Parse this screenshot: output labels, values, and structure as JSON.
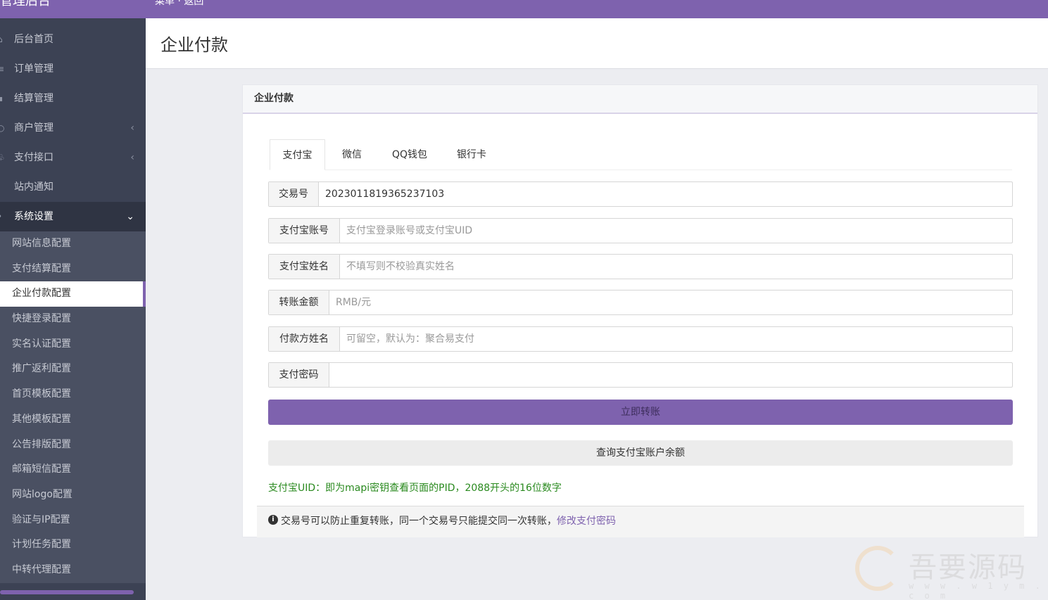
{
  "topbar": {
    "brand": "管理后台",
    "crumbs": "菜单 · 返回"
  },
  "sidebar": {
    "items": [
      {
        "label": "后台首页",
        "icon": "home-icon"
      },
      {
        "label": "订单管理",
        "icon": "list-icon"
      },
      {
        "label": "结算管理",
        "icon": "settle-icon"
      },
      {
        "label": "商户管理",
        "icon": "user-icon",
        "chevron": "‹"
      },
      {
        "label": "支付接口",
        "icon": "plug-icon",
        "chevron": "‹"
      },
      {
        "label": "站内通知",
        "icon": "bell-icon"
      },
      {
        "label": "系统设置",
        "icon": "gear-icon",
        "chevron": "⌄"
      }
    ],
    "submenu": [
      "网站信息配置",
      "支付结算配置",
      "企业付款配置",
      "快捷登录配置",
      "实名认证配置",
      "推广返利配置",
      "首页模板配置",
      "其他模板配置",
      "公告排版配置",
      "邮箱短信配置",
      "网站logo配置",
      "验证与IP配置",
      "计划任务配置",
      "中转代理配置"
    ],
    "current_sub": "企业付款配置"
  },
  "page": {
    "title": "企业付款"
  },
  "panel": {
    "heading": "企业付款",
    "tabs": [
      "支付宝",
      "微信",
      "QQ钱包",
      "银行卡"
    ],
    "active_tab": "支付宝",
    "fields": {
      "trade_no": {
        "label": "交易号",
        "value": "2023011819365237103"
      },
      "account": {
        "label": "支付宝账号",
        "placeholder": "支付宝登录账号或支付宝UID"
      },
      "name": {
        "label": "支付宝姓名",
        "placeholder": "不填写则不校验真实姓名"
      },
      "amount": {
        "label": "转账金额",
        "placeholder": "RMB/元"
      },
      "payer": {
        "label": "付款方姓名",
        "placeholder": "可留空，默认为：聚合易支付"
      },
      "password": {
        "label": "支付密码",
        "placeholder": ""
      }
    },
    "submit_label": "立即转账",
    "balance_label": "查询支付宝账户余额",
    "note": "支付宝UID：即为mapi密钥查看页面的PID，2088开头的16位数字",
    "info_text": "交易号可以防止重复转账，同一个交易号只能提交同一次转账，",
    "info_link": "修改支付密码"
  },
  "watermark": {
    "text": "吾要源码",
    "url": "w w w . w 1 y m . c o m"
  },
  "colors": {
    "accent": "#7e62ae",
    "sidebar": "#3c4254",
    "note_green": "#2a8a1f"
  }
}
